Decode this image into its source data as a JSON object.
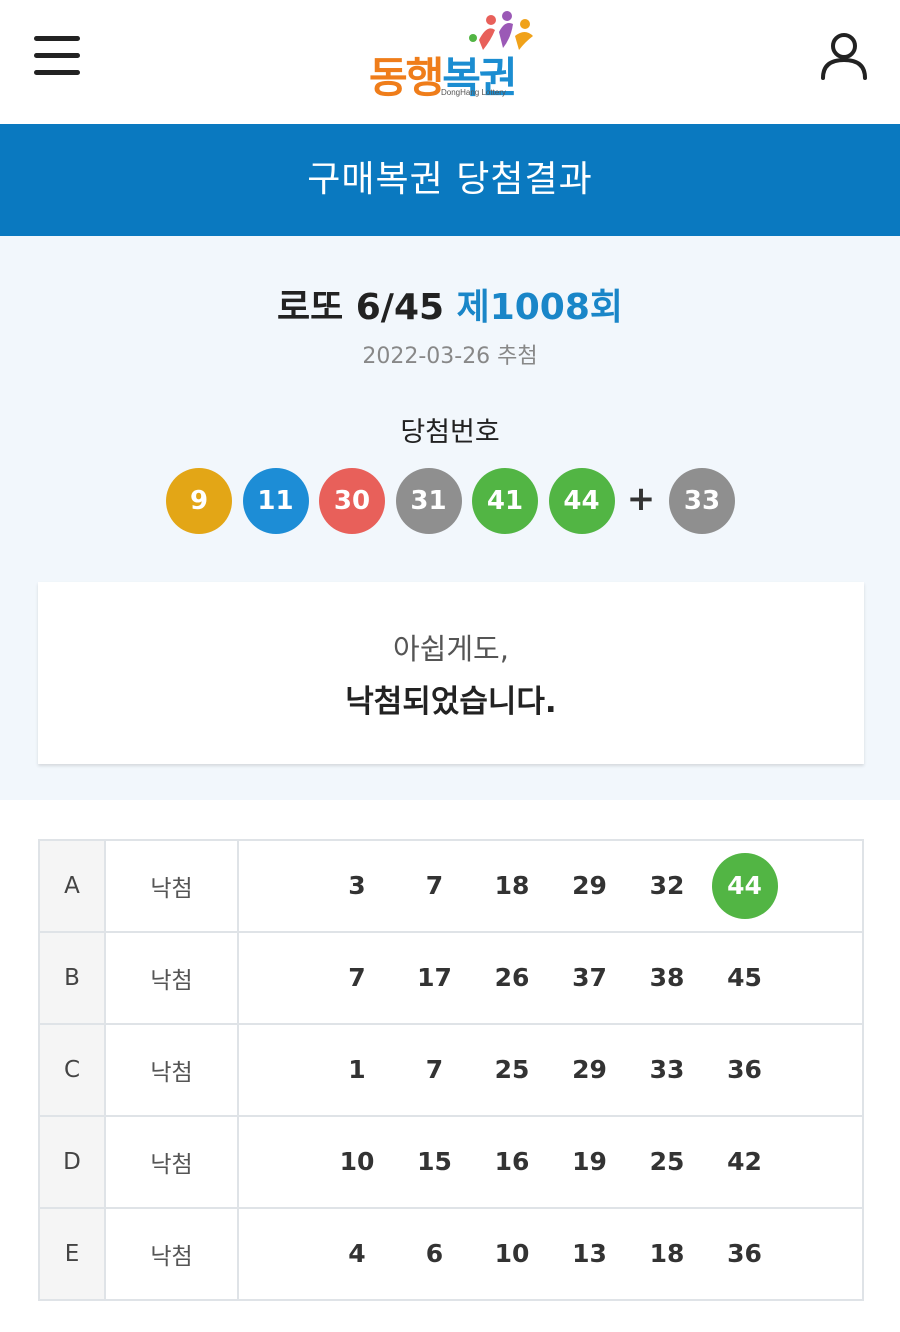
{
  "header": {
    "logo_text": [
      "동",
      "행",
      "복",
      "권"
    ],
    "logo_sub": "DongHang Lottery"
  },
  "title_bar": {
    "title": "구매복권 당첨결과"
  },
  "draw": {
    "game_name": "로또 6/45",
    "round": "제1008회",
    "date_text": "2022-03-26 추첨",
    "win_label": "당첨번호",
    "winning_numbers": [
      {
        "n": "9",
        "color": "#e3a616"
      },
      {
        "n": "11",
        "color": "#1d8dd6"
      },
      {
        "n": "30",
        "color": "#e8605a"
      },
      {
        "n": "31",
        "color": "#8f8f8f"
      },
      {
        "n": "41",
        "color": "#52b544"
      },
      {
        "n": "44",
        "color": "#52b544"
      }
    ],
    "plus": "+",
    "bonus": {
      "n": "33",
      "color": "#8f8f8f"
    }
  },
  "result": {
    "line1": "아쉽게도,",
    "line2": "낙첨되었습니다."
  },
  "colors": {
    "accent": "#0a79c0",
    "hit": "#52b544"
  },
  "tickets": [
    {
      "game": "A",
      "status": "낙첨",
      "numbers": [
        "3",
        "7",
        "18",
        "29",
        "32",
        "44"
      ],
      "hits": [
        5
      ]
    },
    {
      "game": "B",
      "status": "낙첨",
      "numbers": [
        "7",
        "17",
        "26",
        "37",
        "38",
        "45"
      ],
      "hits": []
    },
    {
      "game": "C",
      "status": "낙첨",
      "numbers": [
        "1",
        "7",
        "25",
        "29",
        "33",
        "36"
      ],
      "hits": []
    },
    {
      "game": "D",
      "status": "낙첨",
      "numbers": [
        "10",
        "15",
        "16",
        "19",
        "25",
        "42"
      ],
      "hits": []
    },
    {
      "game": "E",
      "status": "낙첨",
      "numbers": [
        "4",
        "6",
        "10",
        "13",
        "18",
        "36"
      ],
      "hits": []
    }
  ],
  "icons": {
    "menu": "hamburger-menu-icon",
    "user": "user-icon"
  }
}
